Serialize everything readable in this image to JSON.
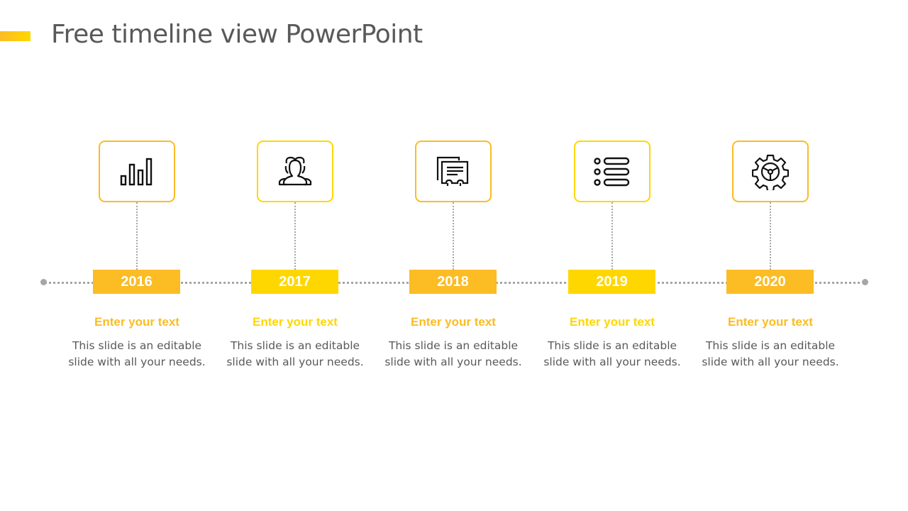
{
  "slide": {
    "title": "Free timeline view PowerPoint",
    "colors": {
      "orange": "#FBBC24",
      "yellow": "#FFD700",
      "line": "#A6A6A6",
      "text": "#595959"
    }
  },
  "timeline": {
    "items": [
      {
        "year": "2016",
        "icon": "bar-chart-icon",
        "heading": "Enter your text",
        "desc1": "This slide is an editable",
        "desc2": "slide with all your needs.",
        "color": "#FBBC24"
      },
      {
        "year": "2017",
        "icon": "users-icon",
        "heading": "Enter your text",
        "desc1": "This slide is an editable",
        "desc2": "slide with all your needs.",
        "color": "#FFD700"
      },
      {
        "year": "2018",
        "icon": "documents-icon",
        "heading": "Enter your text",
        "desc1": "This slide is an editable",
        "desc2": "slide with all your needs.",
        "color": "#FBBC24"
      },
      {
        "year": "2019",
        "icon": "list-icon",
        "heading": "Enter your text",
        "desc1": "This slide is an editable",
        "desc2": "slide with all your needs.",
        "color": "#FFD700"
      },
      {
        "year": "2020",
        "icon": "gear-steering-icon",
        "heading": "Enter your text",
        "desc1": "This slide is an editable",
        "desc2": "slide with all your needs.",
        "color": "#FBBC24"
      }
    ]
  }
}
